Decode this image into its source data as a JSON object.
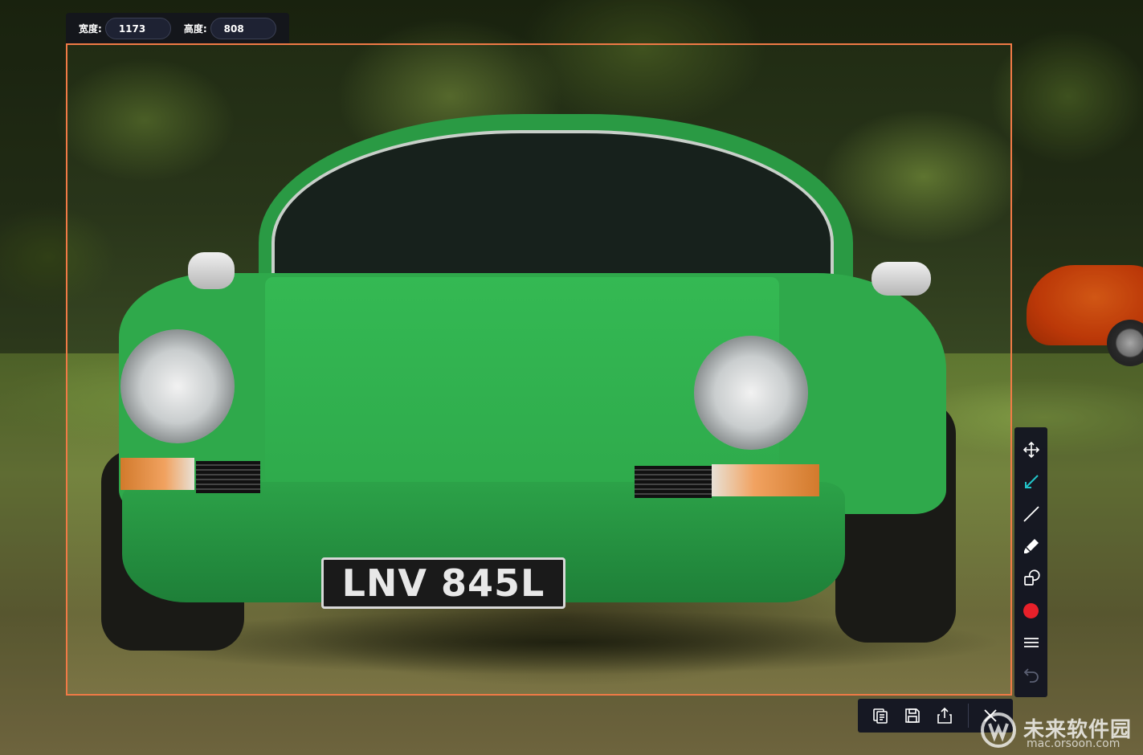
{
  "size_panel": {
    "width_label": "宽度:",
    "width_value": "1173",
    "height_label": "高度:",
    "height_value": "808"
  },
  "photo": {
    "plate_text": "LNV 845L"
  },
  "vertical_toolbar": {
    "tools": [
      {
        "icon": "move-icon"
      },
      {
        "icon": "arrow-icon",
        "active": true
      },
      {
        "icon": "line-icon"
      },
      {
        "icon": "marker-icon"
      },
      {
        "icon": "shape-icon"
      },
      {
        "icon": "color-icon",
        "color": "#e8202a"
      },
      {
        "icon": "stroke-width-icon"
      },
      {
        "icon": "undo-icon",
        "enabled": false
      }
    ]
  },
  "action_toolbar": {
    "actions": [
      {
        "icon": "copy-icon"
      },
      {
        "icon": "save-icon"
      },
      {
        "icon": "share-icon"
      },
      {
        "icon": "close-icon"
      }
    ]
  },
  "watermark": {
    "title": "未来软件园",
    "subtitle": "mac.orsoon.com"
  },
  "colors": {
    "selection_border": "#f07a46",
    "toolbar_bg": "#121422",
    "active_tool": "#22c4c9",
    "color_swatch": "#e8202a"
  }
}
